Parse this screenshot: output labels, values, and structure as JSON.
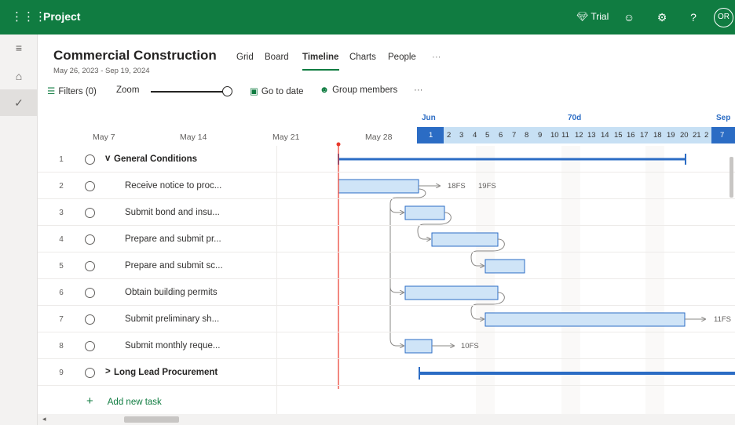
{
  "topbar": {
    "app_name": "Project",
    "trial_label": "Trial",
    "avatar_initials": "OR",
    "help_label": "?"
  },
  "plan": {
    "title": "Commercial Construction",
    "date_range": "May 26, 2023 - Sep 19, 2024"
  },
  "tabs": [
    {
      "label": "Grid"
    },
    {
      "label": "Board"
    },
    {
      "label": "Timeline"
    },
    {
      "label": "Charts"
    },
    {
      "label": "People"
    },
    {
      "label": "···"
    }
  ],
  "toolbar": {
    "filters_label": "Filters (0)",
    "zoom_label": "Zoom",
    "go_to_date_label": "Go to date",
    "group_members_label": "Group members",
    "more_label": "···"
  },
  "week_labels": [
    "May 7",
    "May 14",
    "May 21",
    "May 28"
  ],
  "timeline_header": {
    "month_jun": "Jun",
    "duration": "70d",
    "month_sep": "Sep",
    "days": [
      "1",
      "2",
      "3",
      "4",
      "5",
      "6",
      "7",
      "8",
      "9",
      "10",
      "11",
      "12",
      "13",
      "14",
      "15",
      "16",
      "17",
      "18",
      "19",
      "20",
      "21",
      "2",
      "7"
    ]
  },
  "tasks": [
    {
      "num": "1",
      "name": "General Conditions",
      "group": true,
      "chevron": "v"
    },
    {
      "num": "2",
      "name": "Receive notice to proc...",
      "group": false
    },
    {
      "num": "3",
      "name": "Submit bond and insu...",
      "group": false
    },
    {
      "num": "4",
      "name": "Prepare and submit pr...",
      "group": false
    },
    {
      "num": "5",
      "name": "Prepare and submit sc...",
      "group": false
    },
    {
      "num": "6",
      "name": "Obtain building permits",
      "group": false
    },
    {
      "num": "7",
      "name": "Submit preliminary sh...",
      "group": false
    },
    {
      "num": "8",
      "name": "Submit monthly reque...",
      "group": false
    },
    {
      "num": "9",
      "name": "Long Lead Procurement",
      "group": true,
      "chevron": ">"
    }
  ],
  "dependency_labels": {
    "row2_a": "18FS",
    "row2_b": "19FS",
    "row7": "11FS",
    "row8": "10FS"
  },
  "add_task_label": "Add new task",
  "colors": {
    "brand": "#107c41",
    "bar_fill": "#cfe4f7",
    "bar_border": "#2b6cc4",
    "today_line": "#e8382b"
  }
}
